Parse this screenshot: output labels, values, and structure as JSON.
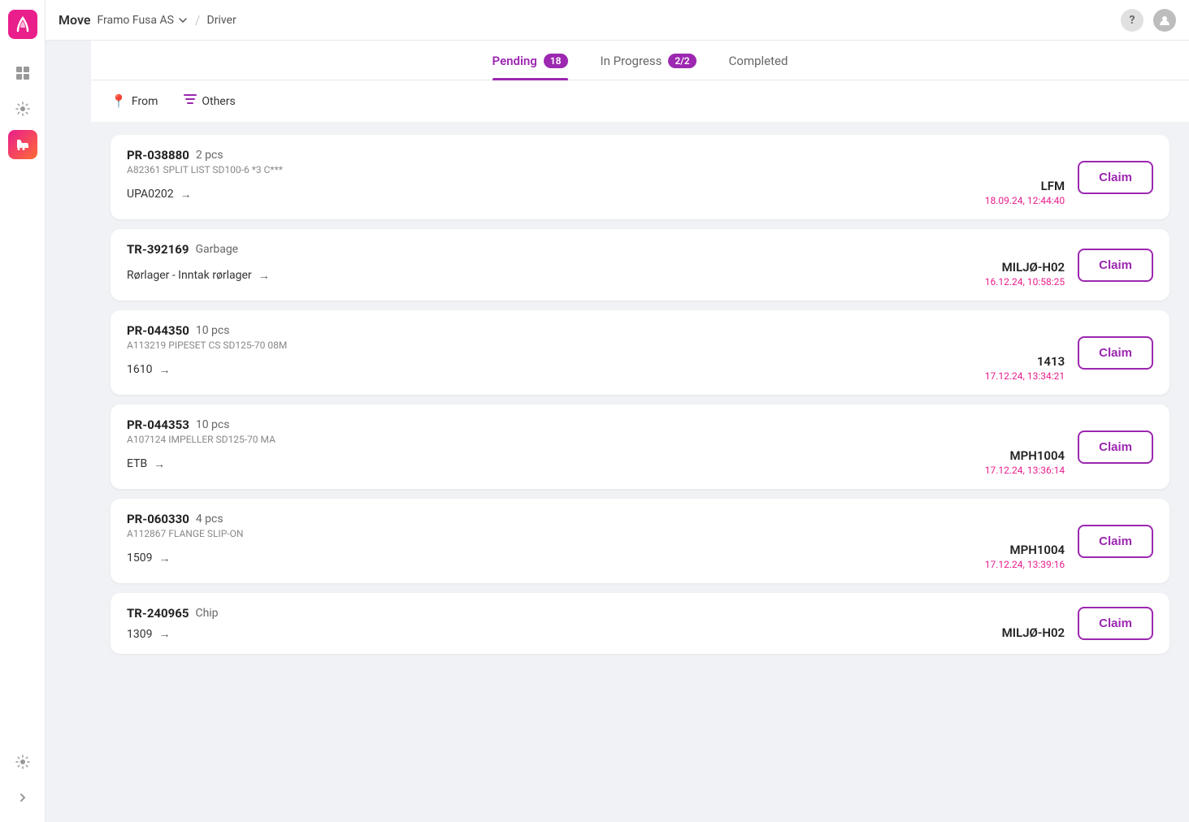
{
  "app": {
    "title": "Move",
    "company": "Framo Fusa AS",
    "breadcrumb": "Driver"
  },
  "tabs": [
    {
      "id": "pending",
      "label": "Pending",
      "badge": "18",
      "active": true
    },
    {
      "id": "in-progress",
      "label": "In Progress",
      "badge": "2/2",
      "active": false
    },
    {
      "id": "completed",
      "label": "Completed",
      "badge": null,
      "active": false
    }
  ],
  "filters": [
    {
      "id": "from",
      "label": "From",
      "icon": "📍"
    },
    {
      "id": "others",
      "label": "Others",
      "icon": "≡"
    }
  ],
  "cards": [
    {
      "id": "PR-038880",
      "type": "2 pcs",
      "desc": "A82361 SPLIT LIST SD100-6 *3 C***",
      "from": "UPA0202",
      "to": "LFM",
      "datetime": "18.09.24, 12:44:40"
    },
    {
      "id": "TR-392169",
      "type": "Garbage",
      "desc": null,
      "from": "Rørlager - Inntak rørlager",
      "to": "MILJØ-H02",
      "datetime": "16.12.24, 10:58:25"
    },
    {
      "id": "PR-044350",
      "type": "10 pcs",
      "desc": "A113219 PIPESET CS SD125-70 08M",
      "from": "1610",
      "to": "1413",
      "datetime": "17.12.24, 13:34:21"
    },
    {
      "id": "PR-044353",
      "type": "10 pcs",
      "desc": "A107124 IMPELLER SD125-70 MA",
      "from": "ETB",
      "to": "MPH1004",
      "datetime": "17.12.24, 13:36:14"
    },
    {
      "id": "PR-060330",
      "type": "4 pcs",
      "desc": "A112867 FLANGE SLIP-ON",
      "from": "1509",
      "to": "MPH1004",
      "datetime": "17.12.24, 13:39:16"
    },
    {
      "id": "TR-240965",
      "type": "Chip",
      "desc": null,
      "from": "1309",
      "to": "MILJØ-H02",
      "datetime": ""
    }
  ],
  "labels": {
    "claim": "Claim",
    "arrow": "→"
  },
  "sidebar": {
    "items": [
      {
        "id": "dashboard",
        "icon": "⊞",
        "active": false
      },
      {
        "id": "settings",
        "icon": "⚙",
        "active": false
      },
      {
        "id": "forklift",
        "icon": "🚜",
        "active": true
      }
    ],
    "bottom": [
      {
        "id": "bottom-settings",
        "icon": "⚙"
      },
      {
        "id": "expand",
        "icon": "›"
      }
    ]
  }
}
